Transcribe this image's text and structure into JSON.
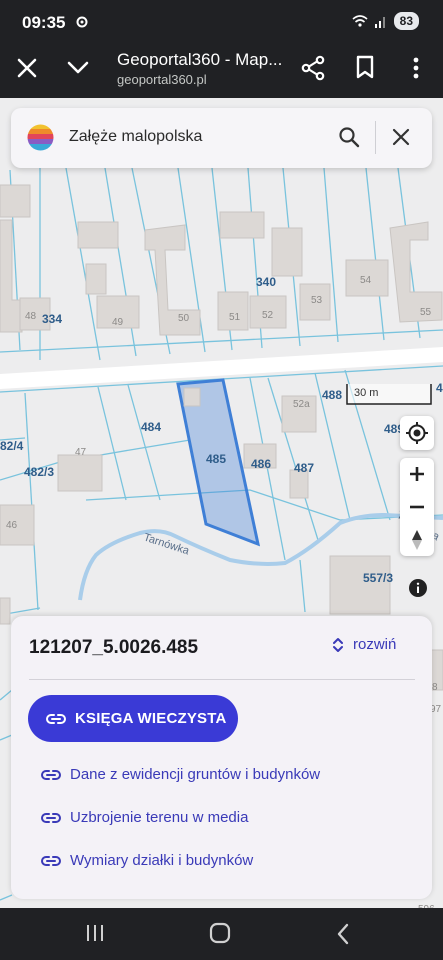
{
  "status_bar": {
    "time": "09:35",
    "battery": "83"
  },
  "browser": {
    "title": "Geoportal360 - Map...",
    "url": "geoportal360.pl"
  },
  "search": {
    "query": "Załęże malopolska"
  },
  "map": {
    "scale_label": "30 m",
    "parcel_labels": [
      "334",
      "340",
      "484",
      "485",
      "486",
      "487",
      "488",
      "489",
      "482/3",
      "82/4",
      "557/3",
      "4"
    ],
    "building_labels": [
      "48",
      "49",
      "50",
      "51",
      "52",
      "53",
      "54",
      "55",
      "47",
      "46",
      "52a",
      "8",
      "97",
      "596"
    ],
    "river_name": "Tarnówka",
    "river_name_right": "Tarnówka",
    "selected_color": "#3f7fd6"
  },
  "panel": {
    "parcel_id": "121207_5.0026.485",
    "expand_label": "rozwiń",
    "primary_button": "KSIĘGA WIECZYSTA",
    "links": [
      "Dane z ewidencji gruntów i budynków",
      "Uzbrojenie terenu w media",
      "Wymiary działki i budynków"
    ]
  }
}
